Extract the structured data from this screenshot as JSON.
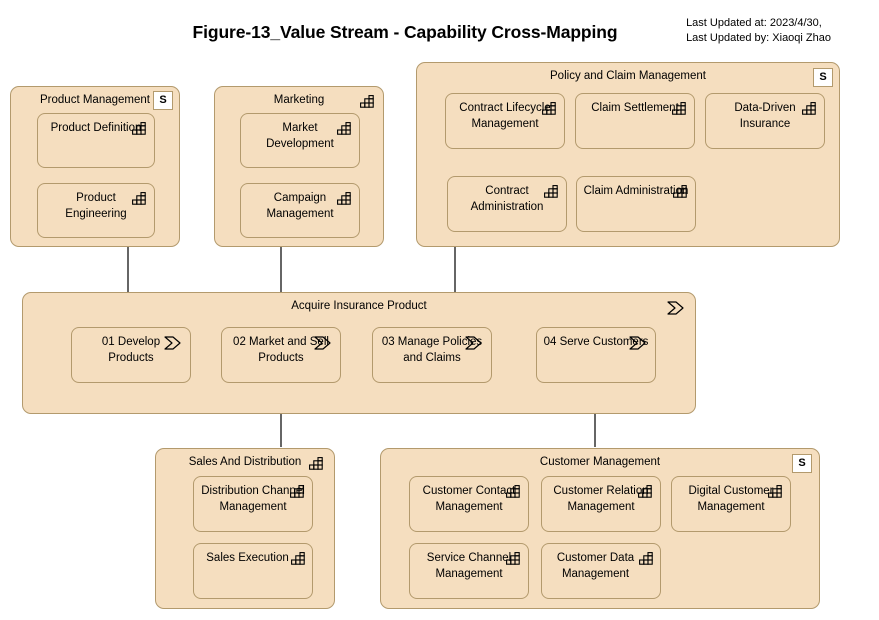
{
  "header": {
    "title": "Figure-13_Value Stream - Capability Cross-Mapping",
    "last_updated_at": "Last Updated at: 2023/4/30,",
    "last_updated_by": "Last Updated by: Xiaoqi Zhao"
  },
  "colors": {
    "element_fill": "#f5debf",
    "element_border": "#b39a6d",
    "badge_fill": "#ffffff",
    "connector": "#000000",
    "text": "#000000"
  },
  "icons": {
    "capability": "capability-icon",
    "value_stream": "value-stream-icon",
    "specialization_badge": "S"
  },
  "groups": [
    {
      "id": "product-management",
      "title": "Product Management",
      "header_icon": "badge-s",
      "badge": "S",
      "elements": [
        {
          "label": "Product Definition",
          "icon": "capability-icon"
        },
        {
          "label": "Product Engineering",
          "icon": "capability-icon"
        }
      ]
    },
    {
      "id": "marketing",
      "title": "Marketing",
      "header_icon": "capability-icon",
      "elements": [
        {
          "label": "Market Development",
          "icon": "capability-icon"
        },
        {
          "label": "Campaign Management",
          "icon": "capability-icon"
        }
      ]
    },
    {
      "id": "policy-and-claim-management",
      "title": "Policy and Claim Management",
      "header_icon": "badge-s",
      "badge": "S",
      "elements": [
        {
          "label": "Contract Lifecycle Management",
          "icon": "capability-icon"
        },
        {
          "label": "Claim Settlement",
          "icon": "capability-icon"
        },
        {
          "label": "Data-Driven Insurance",
          "icon": "capability-icon"
        },
        {
          "label": "Contract Administration",
          "icon": "capability-icon"
        },
        {
          "label": "Claim Administration",
          "icon": "capability-icon"
        }
      ]
    },
    {
      "id": "sales-and-distribution",
      "title": "Sales And Distribution",
      "header_icon": "capability-icon",
      "elements": [
        {
          "label": "Distribution Channel Management",
          "icon": "capability-icon"
        },
        {
          "label": "Sales Execution",
          "icon": "capability-icon"
        }
      ]
    },
    {
      "id": "customer-management",
      "title": "Customer Management",
      "header_icon": "badge-s",
      "badge": "S",
      "elements": [
        {
          "label": "Customer Contact Management",
          "icon": "capability-icon"
        },
        {
          "label": "Customer Relation Management",
          "icon": "capability-icon"
        },
        {
          "label": "Digital Customer Management",
          "icon": "capability-icon"
        },
        {
          "label": "Service Channel Management",
          "icon": "capability-icon"
        },
        {
          "label": "Customer Data Management",
          "icon": "capability-icon"
        }
      ]
    }
  ],
  "value_stream": {
    "id": "acquire-insurance-product",
    "title": "Acquire Insurance Product",
    "header_icon": "value-stream-icon",
    "stages": [
      {
        "label": "01 Develop Products",
        "icon": "value-stream-icon"
      },
      {
        "label": "02 Market and Sell Products",
        "icon": "value-stream-icon"
      },
      {
        "label": "03 Manage Policies and Claims",
        "icon": "value-stream-icon"
      },
      {
        "label": "04 Serve Customers",
        "icon": "value-stream-icon"
      }
    ]
  }
}
